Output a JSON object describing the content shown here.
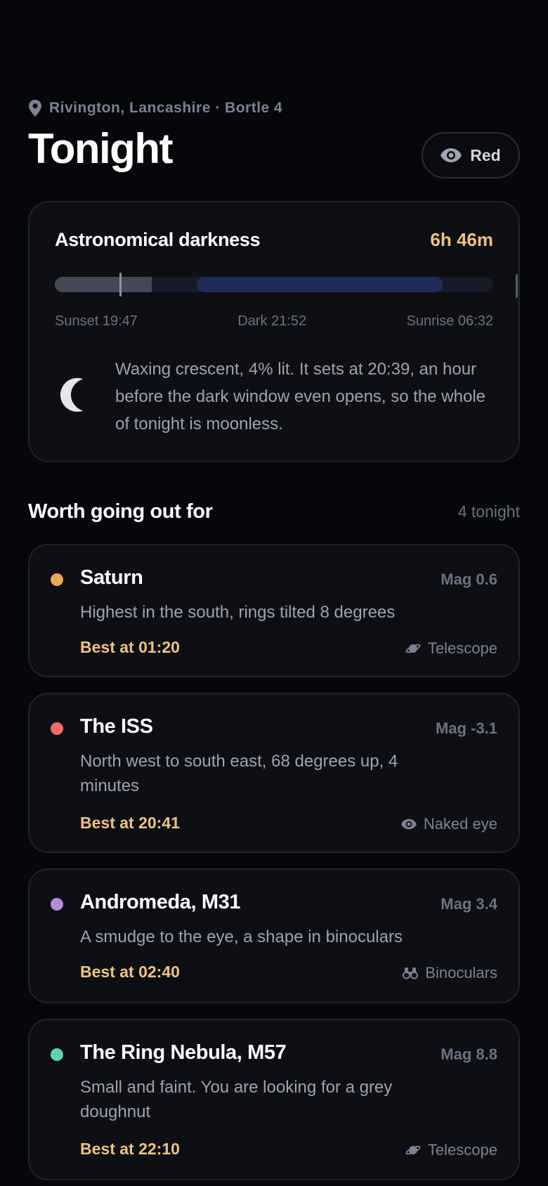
{
  "location": {
    "text": "Rivington, Lancashire · Bortle 4",
    "icon": "location-pin-icon"
  },
  "header": {
    "title": "Tonight",
    "mode_button_label": "Red",
    "mode_icon": "eye-icon"
  },
  "darkness": {
    "title": "Astronomical darkness",
    "duration": "6h 46m",
    "timeline": {
      "dusk_fraction": 0.22,
      "dark_start_fraction": 0.32,
      "dark_end_fraction": 0.88,
      "now_fraction": 0.15
    },
    "labels": {
      "sunset": "Sunset 19:47",
      "dark": "Dark 21:52",
      "sunrise": "Sunrise 06:32"
    },
    "moon_icon": "crescent-moon-icon",
    "moon_text": "Waxing crescent, 4% lit. It sets at 20:39, an hour before the dark window even opens, so the whole of tonight is moonless."
  },
  "section": {
    "title": "Worth going out for",
    "count": "4 tonight"
  },
  "objects": [
    {
      "name": "Saturn",
      "mag": "Mag 0.6",
      "desc": "Highest in the south, rings tilted 8 degrees",
      "best": "Best at 01:20",
      "tool": "Telescope",
      "tool_icon": "planet-icon",
      "dot_color": "#e9aa5c"
    },
    {
      "name": "The ISS",
      "mag": "Mag -3.1",
      "desc": "North west to south east, 68 degrees up, 4 minutes",
      "best": "Best at 20:41",
      "tool": "Naked eye",
      "tool_icon": "eye-icon",
      "dot_color": "#ef6a6a"
    },
    {
      "name": "Andromeda, M31",
      "mag": "Mag 3.4",
      "desc": "A smudge to the eye, a shape in binoculars",
      "best": "Best at 02:40",
      "tool": "Binoculars",
      "tool_icon": "binoculars-icon",
      "dot_color": "#b98ad9"
    },
    {
      "name": "The Ring Nebula, M57",
      "mag": "Mag 8.8",
      "desc": "Small and faint. You are looking for a grey doughnut",
      "best": "Best at 22:10",
      "tool": "Telescope",
      "tool_icon": "planet-icon",
      "dot_color": "#5fd3b3"
    }
  ],
  "colors": {
    "background": "#06070a",
    "card": "#0e0f15",
    "accent": "#efc27f",
    "muted": "#6c7183"
  }
}
